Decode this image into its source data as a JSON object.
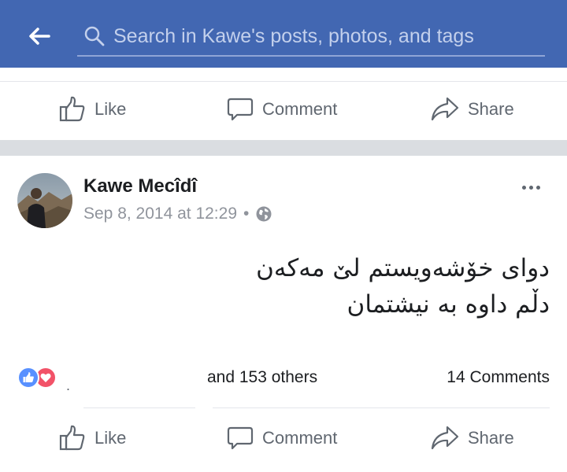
{
  "search": {
    "placeholder": "Search in Kawe's posts, photos, and tags"
  },
  "action_bar": {
    "like_label": "Like",
    "comment_label": "Comment",
    "share_label": "Share"
  },
  "post": {
    "author": "Kawe Mecîdî",
    "timestamp": "Sep 8, 2014 at 12:29",
    "separator": "•",
    "privacy_icon": "globe-icon",
    "text_lines": [
      "دوای خۆشەویستم لێ مەکەن",
      "دڵم داوە بە نیشتمان"
    ],
    "reactions": {
      "icons": [
        "like-reaction-icon",
        "love-reaction-icon"
      ],
      "likes_text": "and 153 others",
      "comments_text": "14 Comments"
    }
  },
  "colors": {
    "brand": "#4267b2",
    "like_blue": "#5890ff",
    "love_red": "#f25268",
    "muted_text": "#606770"
  }
}
